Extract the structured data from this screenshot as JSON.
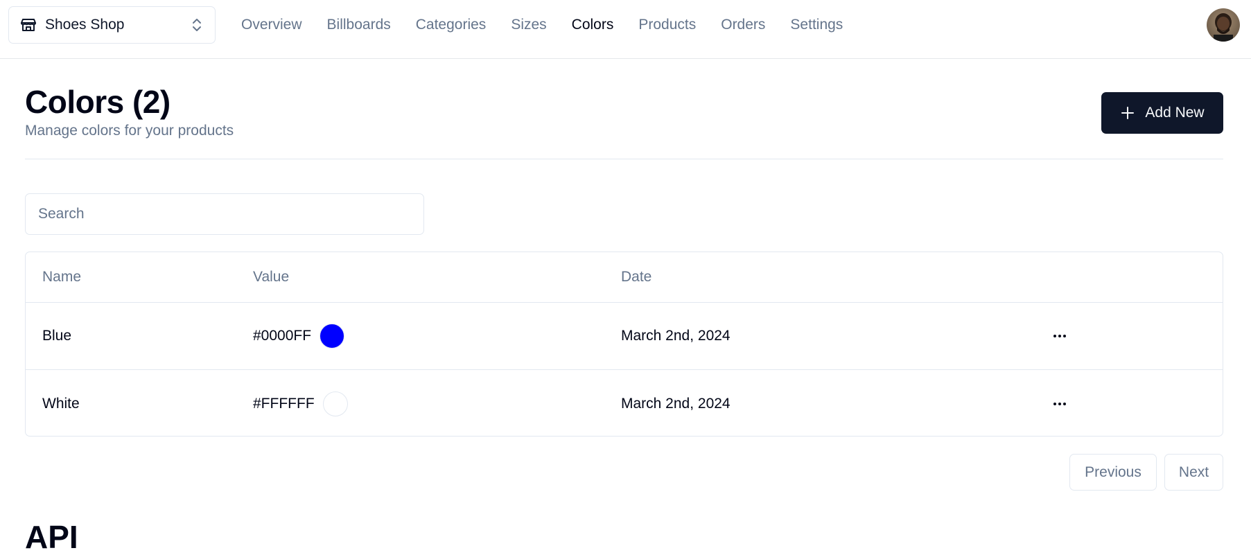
{
  "header": {
    "store_name": "Shoes Shop",
    "nav": [
      {
        "label": "Overview",
        "active": false
      },
      {
        "label": "Billboards",
        "active": false
      },
      {
        "label": "Categories",
        "active": false
      },
      {
        "label": "Sizes",
        "active": false
      },
      {
        "label": "Colors",
        "active": true
      },
      {
        "label": "Products",
        "active": false
      },
      {
        "label": "Orders",
        "active": false
      },
      {
        "label": "Settings",
        "active": false
      }
    ]
  },
  "page": {
    "title": "Colors (2)",
    "subtitle": "Manage colors for your products",
    "add_label": "Add New"
  },
  "search": {
    "placeholder": "Search",
    "value": ""
  },
  "table": {
    "columns": [
      "Name",
      "Value",
      "Date"
    ],
    "rows": [
      {
        "name": "Blue",
        "value": "#0000FF",
        "date": "March 2nd, 2024"
      },
      {
        "name": "White",
        "value": "#FFFFFF",
        "date": "March 2nd, 2024"
      }
    ]
  },
  "pagination": {
    "previous_label": "Previous",
    "next_label": "Next"
  },
  "api_section": {
    "title": "API"
  },
  "colors": {
    "primary": "#0f172a",
    "muted_text": "#64748b",
    "border": "#e2e8f0"
  },
  "icons": {
    "store": "store-icon",
    "chevrons": "chevrons-up-down-icon",
    "plus": "plus-icon",
    "more": "more-horizontal-icon"
  }
}
